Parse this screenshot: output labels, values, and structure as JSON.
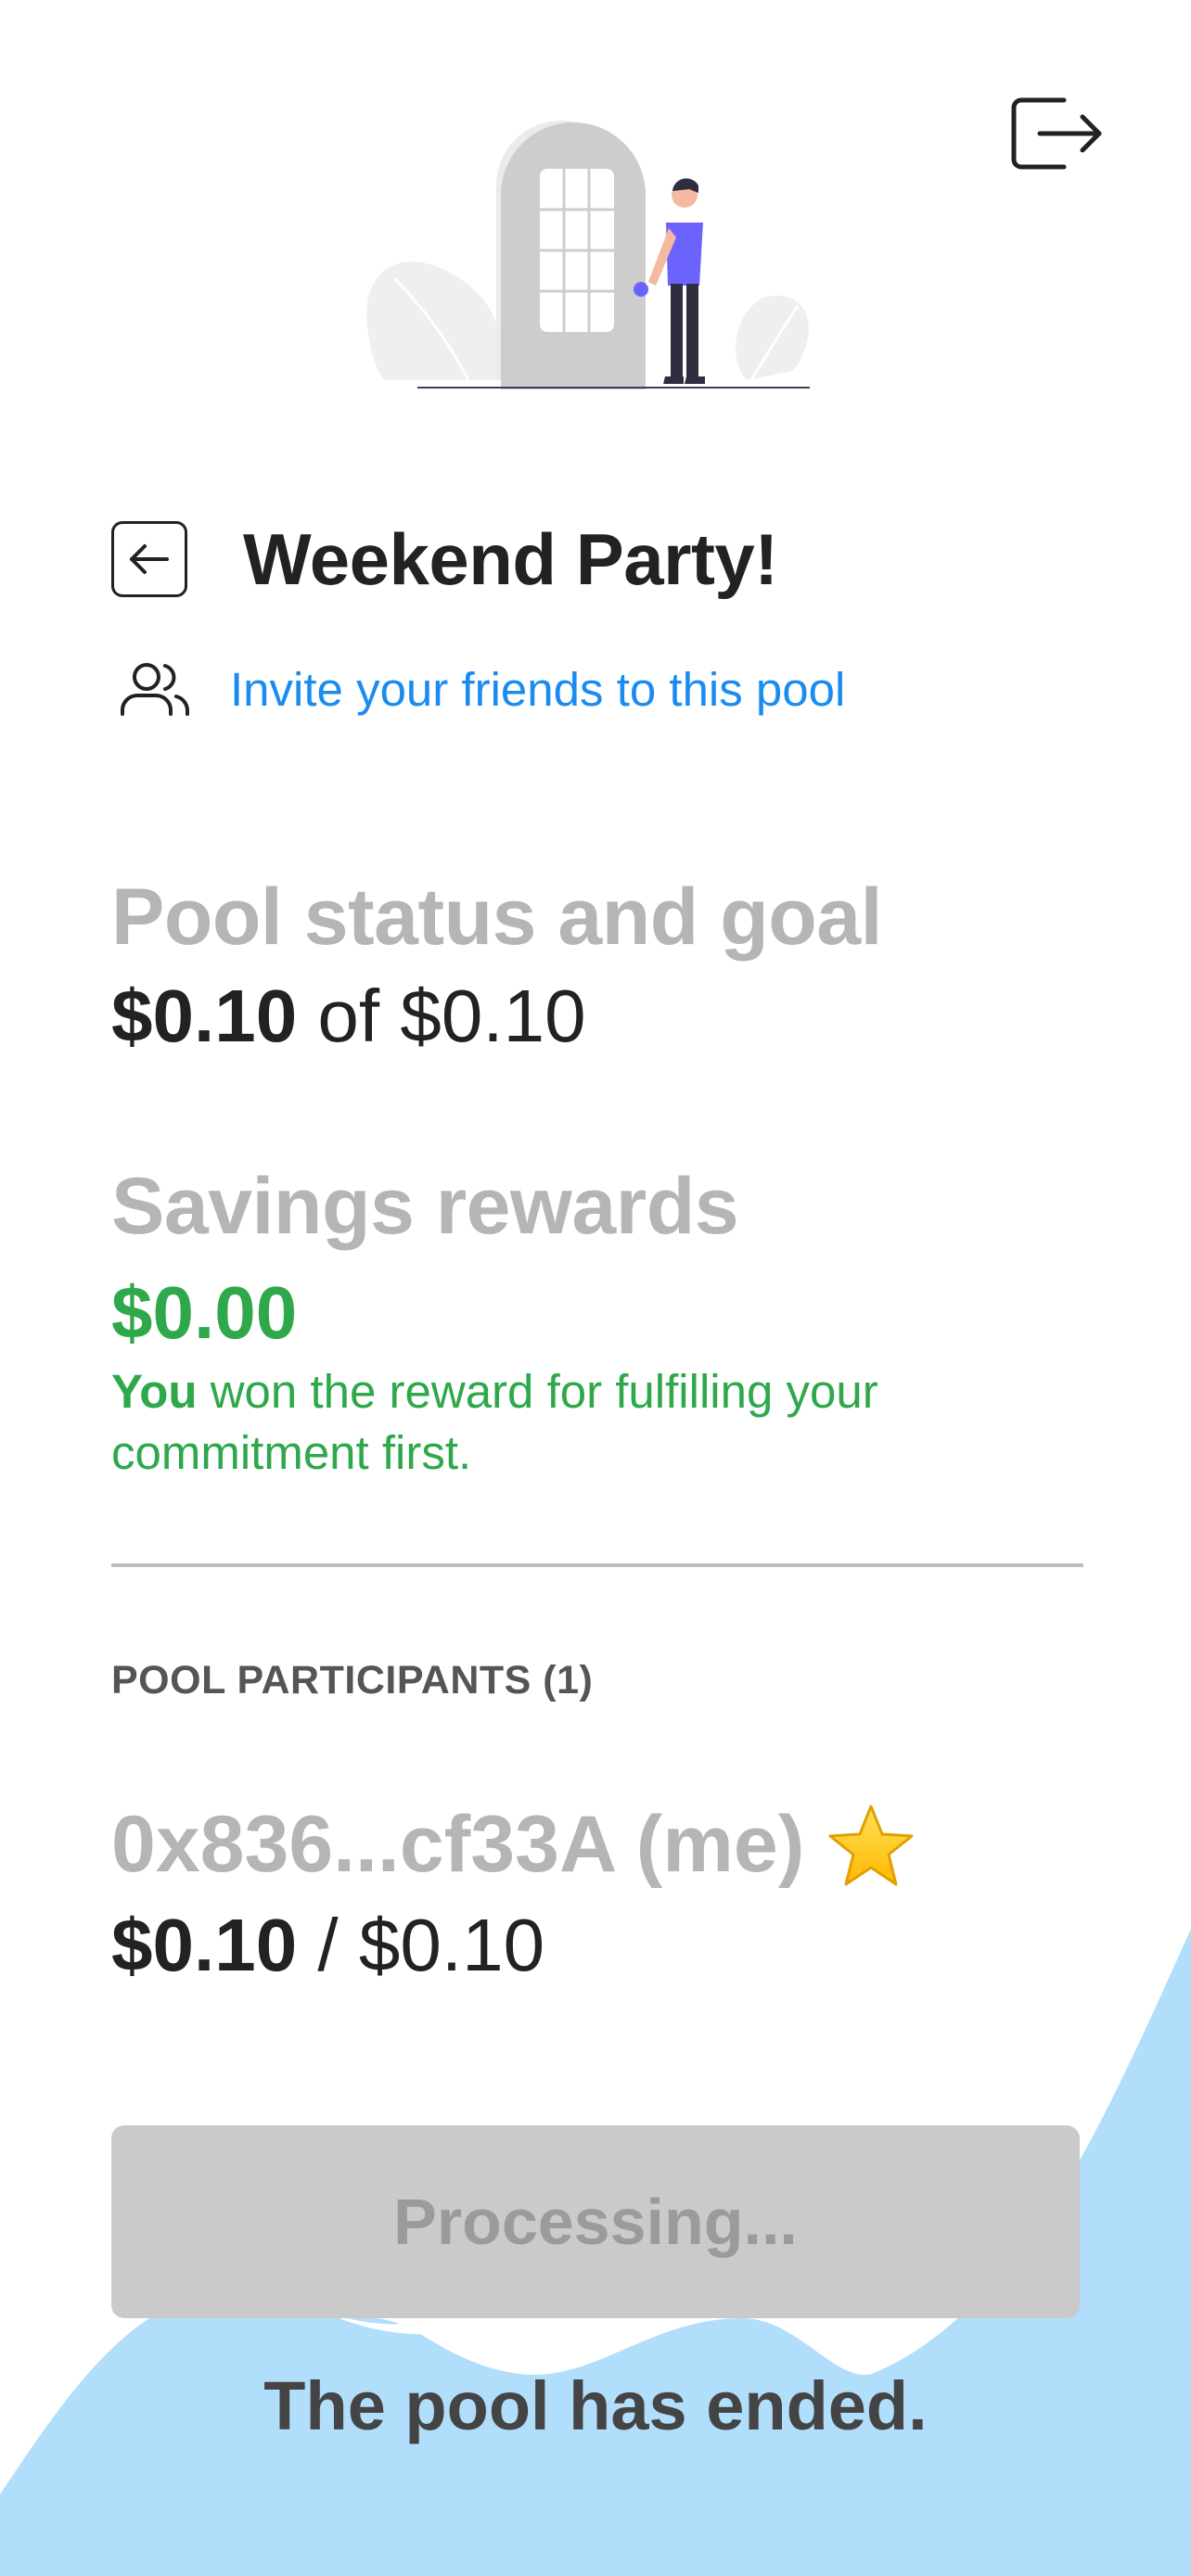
{
  "header": {
    "logout_icon": "logout-arrow-icon",
    "hero_illustration": "person-at-door-illustration"
  },
  "pool": {
    "title": "Weekend Party!",
    "back_icon": "arrow-left-icon",
    "invite_icon": "users-icon",
    "invite_label": "Invite your friends to this pool"
  },
  "status": {
    "heading": "Pool status and goal",
    "current": "$0.10",
    "separator": " of ",
    "goal": "$0.10"
  },
  "rewards": {
    "heading": "Savings rewards",
    "amount": "$0.00",
    "note_strong": "You",
    "note_rest": " won the reward for fulfilling your commitment first."
  },
  "participants": {
    "label": "POOL PARTICIPANTS (1)",
    "items": [
      {
        "name": "0x836...cf33A (me)",
        "badge_icon": "star-icon",
        "saved": "$0.10",
        "separator": " / ",
        "goal": "$0.10"
      }
    ]
  },
  "actions": {
    "processing_label": "Processing..."
  },
  "footer": {
    "ended_text": "The pool has ended."
  },
  "colors": {
    "accent_link": "#1a8cf0",
    "reward_green": "#2ea84a",
    "muted_heading": "#b5b5b5",
    "wave_blue": "#b0defb",
    "hero_purple": "#6c63ff"
  }
}
